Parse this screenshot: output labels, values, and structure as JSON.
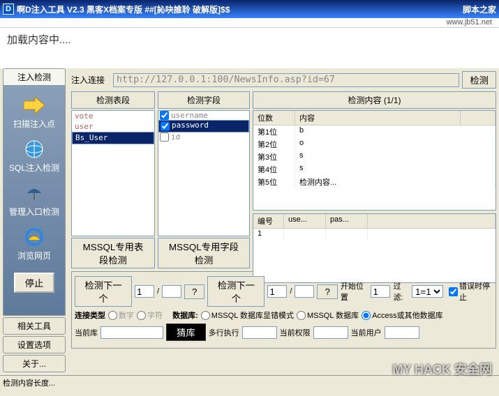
{
  "titlebar": {
    "icon_letter": "D",
    "title": "啊D注入工具  V2.3  黑客X档案专版  ##[訫吷誰聆  破解版]$$",
    "brand": "脚本之家"
  },
  "subtitle_url": "www.jb51.net",
  "loading_text": "加载内容中....",
  "sidebar": {
    "header": "注入检测",
    "items": [
      {
        "label": "扫描注入点",
        "icon": "arrow"
      },
      {
        "label": "SQL注入检测",
        "icon": "globe"
      },
      {
        "label": "管理入口检测",
        "icon": "umbrella"
      },
      {
        "label": "浏览网页",
        "icon": "ie"
      }
    ],
    "stop_label": "停止",
    "bottom_tabs": [
      "相关工具",
      "设置选项",
      "关于..."
    ]
  },
  "url_section": {
    "label": "注入连接",
    "url": "http://127.0.0.1:100/NewsInfo.asp?id=67",
    "detect_btn": "检测"
  },
  "tables_panel": {
    "header": "检测表段",
    "items": [
      "vote",
      "user",
      "Bs_User"
    ],
    "selected": 2,
    "mssql_btn": "MSSQL专用表段检测"
  },
  "fields_panel": {
    "header": "检测字段",
    "items": [
      {
        "name": "username",
        "checked": true,
        "sel": false
      },
      {
        "name": "password",
        "checked": true,
        "sel": true
      },
      {
        "name": "id",
        "checked": false,
        "sel": false
      }
    ],
    "mssql_btn": "MSSQL专用字段检测"
  },
  "content_panel": {
    "header": "检测内容 (1/1)",
    "cols": [
      "位数",
      "内容"
    ],
    "rows": [
      {
        "pos": "第1位",
        "val": "b"
      },
      {
        "pos": "第2位",
        "val": "o"
      },
      {
        "pos": "第3位",
        "val": "s"
      },
      {
        "pos": "第4位",
        "val": "s"
      },
      {
        "pos": "第5位",
        "val": "检测内容..."
      }
    ],
    "grid2_cols": [
      "编号",
      "use...",
      "pas..."
    ],
    "grid2_rows": [
      {
        "id": "1",
        "u": "",
        "p": ""
      }
    ]
  },
  "bottom": {
    "next_label": "检测下一个",
    "page1a": "1",
    "slash": "/",
    "q": "?",
    "next_label2": "检测下一个",
    "page2a": "1",
    "startpos_label": "开始位置",
    "startpos_val": "1",
    "filter_label": "过滤:",
    "filter_val": "1=1",
    "err_stop_label": "错误时停止",
    "conn_label": "连接类型",
    "conn_num": "数字",
    "conn_char": "字符",
    "db_label": "数据库:",
    "db_mssql_err": "MSSQL 数据库显错模式",
    "db_mssql": "MSSQL 数据库",
    "db_access": "Access或其他数据库",
    "curdb_label": "当前库",
    "guess_label": "猜库",
    "multi_label": "多行执行",
    "curuser_label": "当前权限",
    "cururl_label": "当前用户"
  },
  "statusbar": "检测内容长度...",
  "watermark": "MY HACK 安全网"
}
